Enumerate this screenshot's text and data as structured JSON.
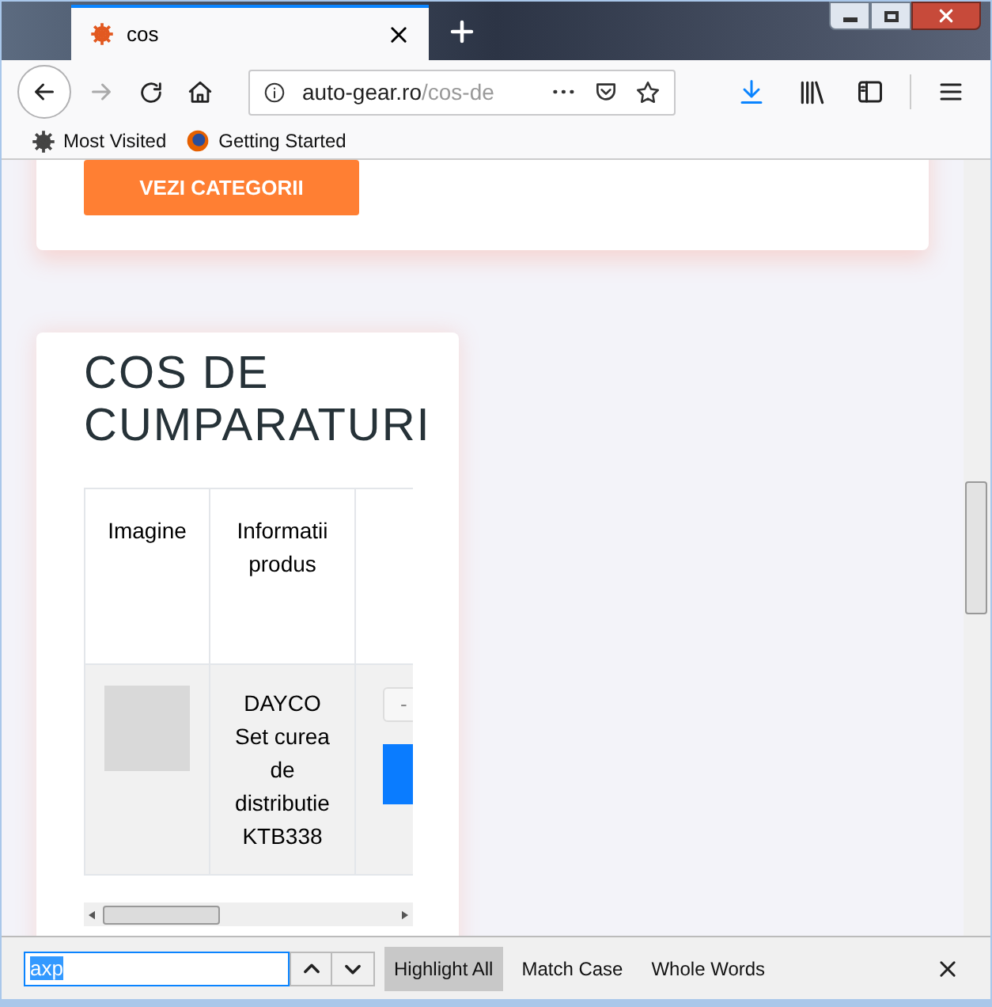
{
  "tab": {
    "title": "cos",
    "selected": true
  },
  "address": {
    "host": "auto-gear.ro",
    "path": "/cos-de"
  },
  "bookmarks": [
    {
      "kind": "gear",
      "label": "Most Visited"
    },
    {
      "kind": "firefox",
      "label": "Getting Started"
    }
  ],
  "page": {
    "category_button": "VEZI CATEGORII",
    "cart_title": "COS DE CUMPARATURI",
    "table": {
      "columns": [
        "Imagine",
        "Informatii produs"
      ],
      "rows": [
        {
          "product": "DAYCO Set curea de distributie KTB338",
          "qty_minus": "-"
        }
      ]
    }
  },
  "find_bar": {
    "value": "axp",
    "options": [
      {
        "label": "Highlight All",
        "selected": true
      },
      {
        "label": "Match Case",
        "selected": false
      },
      {
        "label": "Whole Words",
        "selected": false
      }
    ]
  }
}
